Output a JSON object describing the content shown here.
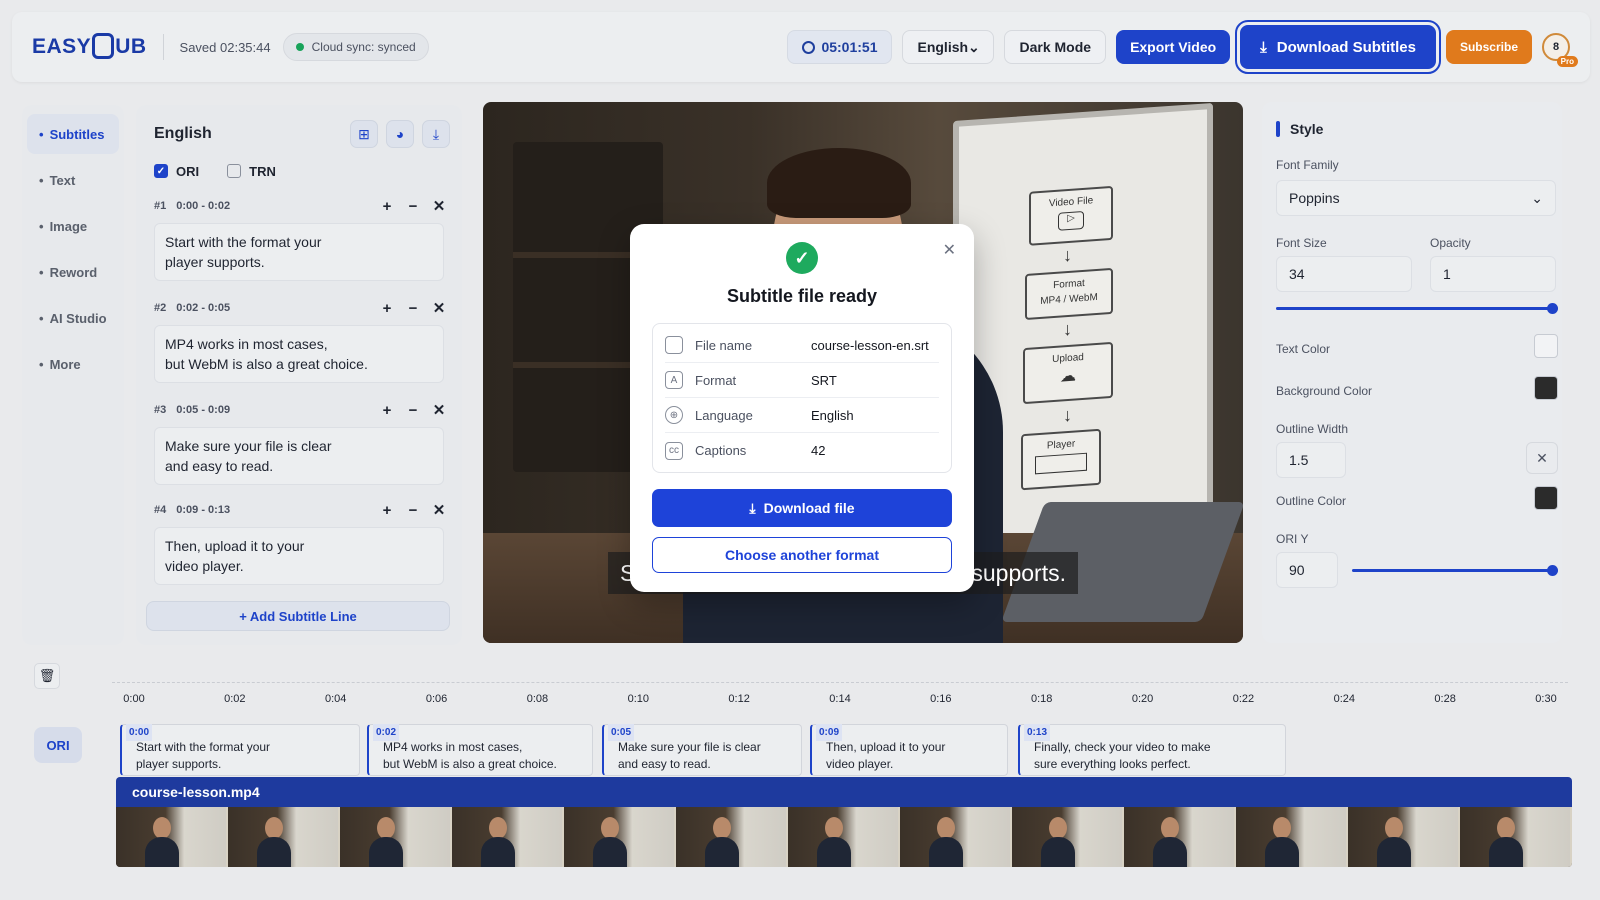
{
  "header": {
    "logo_text": "EASYSUB",
    "logo_prefix": "EASY",
    "logo_suffix": "UB",
    "saved": "Saved 02:35:44",
    "sync": "Cloud sync: synced",
    "timer": "05:01:51",
    "language": "English",
    "dark_mode": "Dark Mode",
    "export": "Export Video",
    "download_subtitles": "Download Subtitles",
    "subscribe": "Subscribe",
    "avatar_initial": "8",
    "avatar_badge": "Pro"
  },
  "leftnav": {
    "items": [
      {
        "label": "Subtitles",
        "active": true
      },
      {
        "label": "Text"
      },
      {
        "label": "Image"
      },
      {
        "label": "Reword"
      },
      {
        "label": "AI Studio"
      },
      {
        "label": "More"
      }
    ]
  },
  "subtitles": {
    "title": "English",
    "ori_label": "ORI",
    "trn_label": "TRN",
    "ori_checked": true,
    "trn_checked": false,
    "cues": [
      {
        "num": "#1",
        "time": "0:00 - 0:02",
        "line1": "Start with the format your",
        "line2": "player supports."
      },
      {
        "num": "#2",
        "time": "0:02 - 0:05",
        "line1": "MP4 works in most cases,",
        "line2": "but WebM is also a great choice."
      },
      {
        "num": "#3",
        "time": "0:05 - 0:09",
        "line1": "Make sure your file is clear",
        "line2": "and easy to read."
      },
      {
        "num": "#4",
        "time": "0:09 - 0:13",
        "line1": "Then, upload it to your",
        "line2": "video player."
      }
    ],
    "add_line": "+ Add Subtitle Line"
  },
  "video": {
    "board": {
      "box1": "Video File",
      "box2_l1": "Format",
      "box2_l2": "MP4 / WebM",
      "box3": "Upload",
      "box4": "Player"
    },
    "caption_left": "S",
    "caption_right": "supports."
  },
  "modal": {
    "title": "Subtitle file ready",
    "rows": [
      {
        "icon": "file-icon",
        "key": "File name",
        "value": "course-lesson-en.srt"
      },
      {
        "icon": "format-icon",
        "key": "Format",
        "value": "SRT"
      },
      {
        "icon": "globe-icon",
        "key": "Language",
        "value": "English"
      },
      {
        "icon": "cc-icon",
        "key": "Captions",
        "value": "42"
      }
    ],
    "primary": "Download file",
    "secondary": "Choose another format"
  },
  "style": {
    "title": "Style",
    "font_family_label": "Font Family",
    "font_family": "Poppins",
    "font_size_label": "Font Size",
    "font_size": "34",
    "opacity_label": "Opacity",
    "opacity": "1",
    "opacity_slider_level": 1.0,
    "text_color_label": "Text Color",
    "text_color": "#f2f3f5",
    "bg_color_label": "Background Color",
    "bg_color": "#2b2b2b",
    "outline_width_label": "Outline Width",
    "outline_width": "1.5",
    "outline_color_label": "Outline Color",
    "outline_color": "#2b2b2b",
    "ori_y_label": "ORI Y",
    "ori_y": "90",
    "ori_y_slider_level": 1.0
  },
  "timeline": {
    "ticks": [
      "0:00",
      "0:02",
      "0:04",
      "0:06",
      "0:08",
      "0:10",
      "0:12",
      "0:14",
      "0:16",
      "0:18",
      "0:20",
      "0:22",
      "0:24",
      "0:28",
      "0:30"
    ],
    "track_label": "ORI",
    "clips": [
      {
        "time": "0:00",
        "line1": "Start with the format your",
        "line2": "player supports."
      },
      {
        "time": "0:02",
        "line1": "MP4 works in most cases,",
        "line2": "but WebM is also a great choice."
      },
      {
        "time": "0:05",
        "line1": "Make sure your file is clear",
        "line2": "and easy to read."
      },
      {
        "time": "0:09",
        "line1": "Then, upload it to your",
        "line2": "video player."
      },
      {
        "time": "0:13",
        "line1": "Finally, check your video to make",
        "line2": "sure everything looks perfect."
      }
    ],
    "video_file": "course-lesson.mp4"
  },
  "colors": {
    "accent": "#1e43c9",
    "success": "#1eaa5e",
    "subscribe": "#e07a1c"
  }
}
